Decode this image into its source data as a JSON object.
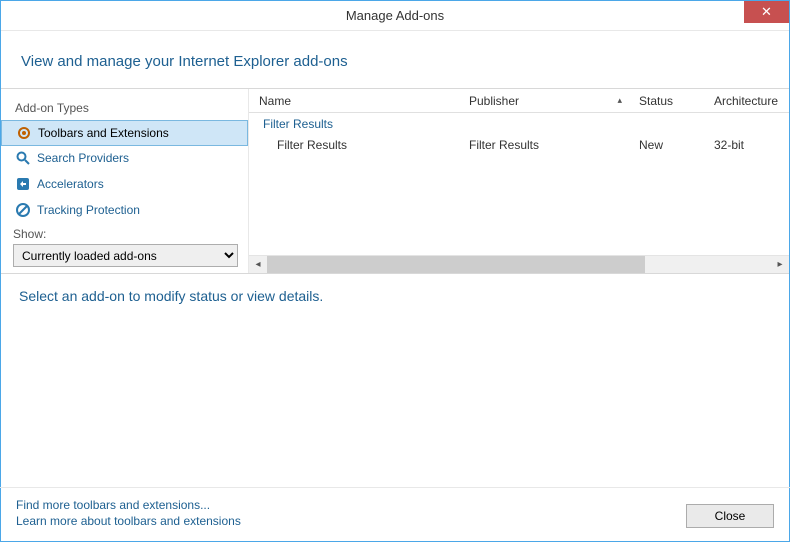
{
  "window": {
    "title": "Manage Add-ons",
    "close_glyph": "✕"
  },
  "header": {
    "text": "View and manage your Internet Explorer add-ons"
  },
  "sidebar": {
    "types_label": "Add-on Types",
    "items": [
      {
        "label": "Toolbars and Extensions",
        "icon": "gear",
        "selected": true
      },
      {
        "label": "Search Providers",
        "icon": "search",
        "selected": false
      },
      {
        "label": "Accelerators",
        "icon": "accel",
        "selected": false
      },
      {
        "label": "Tracking Protection",
        "icon": "block",
        "selected": false
      }
    ],
    "show_label": "Show:",
    "show_value": "Currently loaded add-ons"
  },
  "table": {
    "columns": {
      "name": "Name",
      "publisher": "Publisher",
      "status": "Status",
      "arch": "Architecture"
    },
    "sorted_column": "publisher",
    "group": "Filter Results",
    "rows": [
      {
        "name": "Filter Results",
        "publisher": "Filter Results",
        "status": "New",
        "arch": "32-bit"
      }
    ]
  },
  "details": {
    "prompt": "Select an add-on to modify status or view details."
  },
  "footer": {
    "link1": "Find more toolbars and extensions...",
    "link2": "Learn more about toolbars and extensions",
    "close_label": "Close"
  }
}
